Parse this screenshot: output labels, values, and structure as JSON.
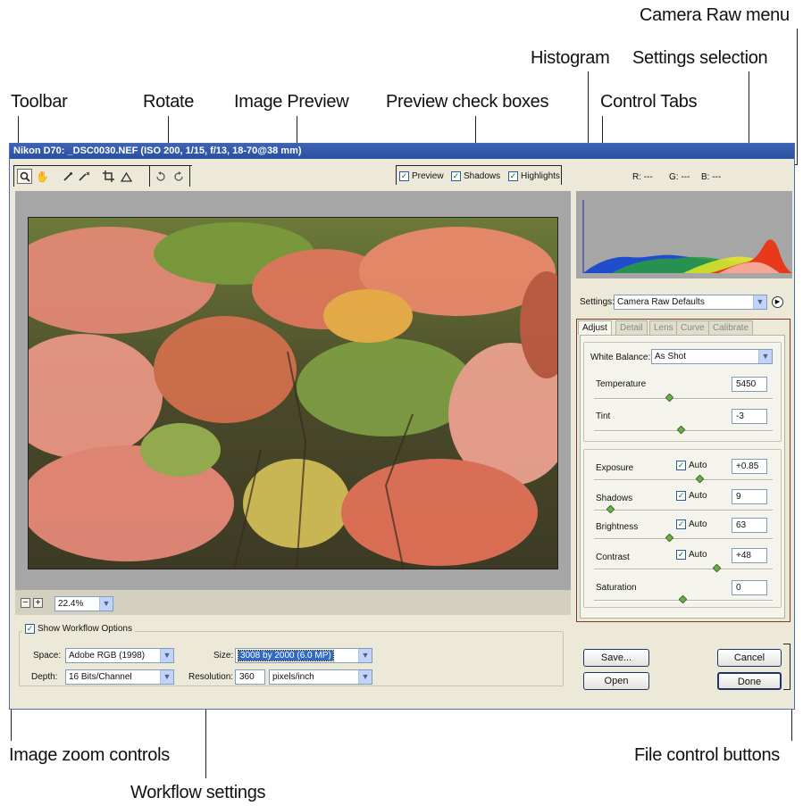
{
  "callouts": {
    "camera_raw_menu": "Camera Raw menu",
    "histogram": "Histogram",
    "settings_selection": "Settings selection",
    "toolbar": "Toolbar",
    "rotate": "Rotate",
    "image_preview": "Image Preview",
    "preview_check_boxes": "Preview check boxes",
    "control_tabs": "Control Tabs",
    "image_zoom_controls": "Image zoom controls",
    "file_control_buttons": "File control buttons",
    "workflow_settings": "Workflow settings"
  },
  "window": {
    "title": "Nikon D70:  _DSC0030.NEF  (ISO 200, 1/15, f/13, 18-70@38 mm)"
  },
  "preview_checks": {
    "preview": "Preview",
    "shadows": "Shadows",
    "highlights": "Highlights"
  },
  "rgb_readout": {
    "r": "R: ---",
    "g": "G: ---",
    "b": "B: ---"
  },
  "settings": {
    "label": "Settings:",
    "value": "Camera Raw Defaults"
  },
  "tabs": [
    "Adjust",
    "Detail",
    "Lens",
    "Curve",
    "Calibrate"
  ],
  "adjust": {
    "white_balance_label": "White Balance:",
    "white_balance_value": "As Shot",
    "temperature": {
      "label": "Temperature",
      "value": "5450",
      "level": 0.42
    },
    "tint": {
      "label": "Tint",
      "value": "-3",
      "level": 0.49
    },
    "auto_label": "Auto",
    "exposure": {
      "label": "Exposure",
      "value": "+0.85",
      "level": 0.6
    },
    "shadows": {
      "label": "Shadows",
      "value": "9",
      "level": 0.08
    },
    "brightness": {
      "label": "Brightness",
      "value": "63",
      "level": 0.42
    },
    "contrast": {
      "label": "Contrast",
      "value": "+48",
      "level": 0.7
    },
    "saturation": {
      "label": "Saturation",
      "value": "0",
      "level": 0.5
    }
  },
  "zoom": {
    "minus": "–",
    "plus": "+",
    "level": "22.4%"
  },
  "workflow": {
    "show_label": "Show Workflow Options",
    "space_label": "Space:",
    "space_value": "Adobe RGB (1998)",
    "size_label": "Size:",
    "size_value": "3008 by 2000  (6.0 MP)",
    "depth_label": "Depth:",
    "depth_value": "16 Bits/Channel",
    "resolution_label": "Resolution:",
    "resolution_value": "360",
    "resolution_unit": "pixels/inch"
  },
  "buttons": {
    "save": "Save...",
    "open": "Open",
    "cancel": "Cancel",
    "done": "Done"
  }
}
